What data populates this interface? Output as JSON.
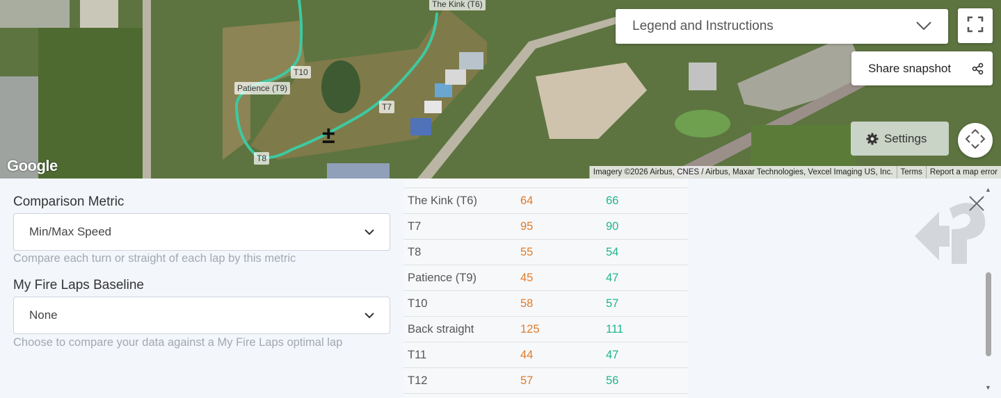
{
  "map": {
    "turn_labels": [
      {
        "id": "t6",
        "text": "The Kink (T6)"
      },
      {
        "id": "t10",
        "text": "T10"
      },
      {
        "id": "t9",
        "text": "Patience (T9)"
      },
      {
        "id": "t7",
        "text": "T7"
      },
      {
        "id": "t8",
        "text": "T8"
      }
    ],
    "legend_label": "Legend and Instructions",
    "share_label": "Share snapshot",
    "settings_label": "Settings",
    "google_logo": "Google",
    "attribution": "Imagery ©2026 Airbus, CNES / Airbus, Maxar Technologies, Vexcel Imaging US, Inc.",
    "terms_label": "Terms",
    "report_label": "Report a map error",
    "zoom_symbol": "±",
    "track_color": "#3ec9a0"
  },
  "panel": {
    "metric_label": "Comparison Metric",
    "metric_value": "Min/Max Speed",
    "metric_hint": "Compare each turn or straight of each lap by this metric",
    "baseline_label": "My Fire Laps Baseline",
    "baseline_value": "None",
    "baseline_hint": "Choose to compare your data against a My Fire Laps optimal lap"
  },
  "table": {
    "rows": [
      {
        "name": "The Kink (T6)",
        "lap1": "64",
        "lap2": "66"
      },
      {
        "name": "T7",
        "lap1": "95",
        "lap2": "90"
      },
      {
        "name": "T8",
        "lap1": "55",
        "lap2": "54"
      },
      {
        "name": "Patience (T9)",
        "lap1": "45",
        "lap2": "47"
      },
      {
        "name": "T10",
        "lap1": "58",
        "lap2": "57"
      },
      {
        "name": "Back straight",
        "lap1": "125",
        "lap2": "111"
      },
      {
        "name": "T11",
        "lap1": "44",
        "lap2": "47"
      },
      {
        "name": "T12",
        "lap1": "57",
        "lap2": "56"
      }
    ],
    "lap1_color": "#e07b2a",
    "lap2_color": "#1fb58a"
  }
}
